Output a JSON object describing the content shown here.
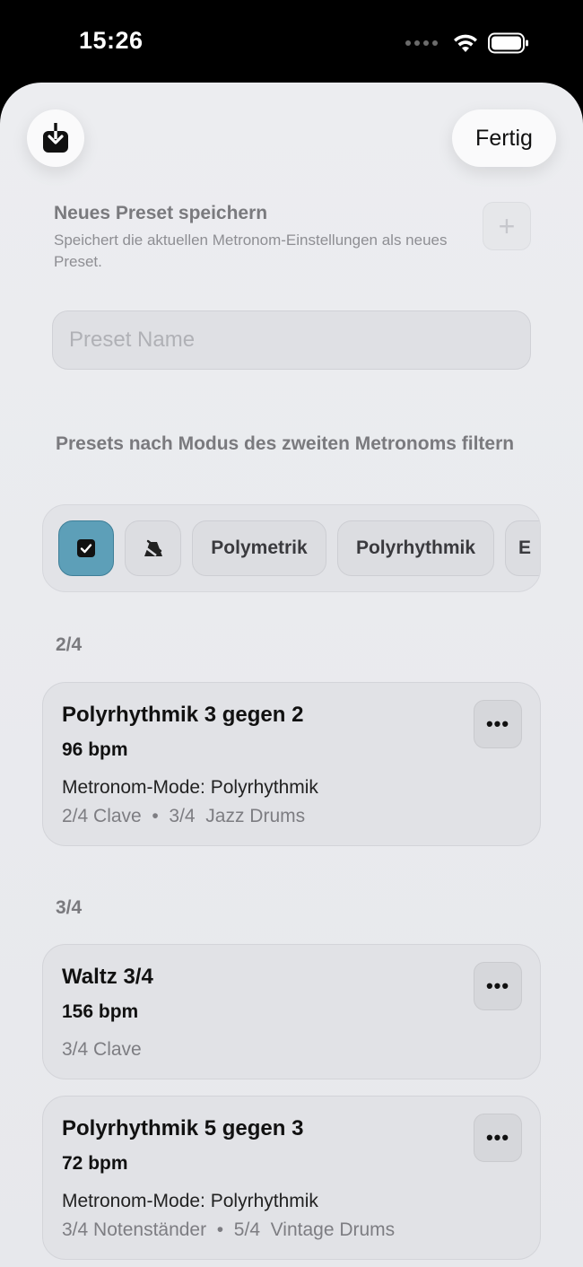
{
  "status_bar": {
    "time": "15:26"
  },
  "header": {
    "done_label": "Fertig"
  },
  "save_section": {
    "title": "Neues Preset speichern",
    "description": "Speichert die aktuellen Metronom-Einstellungen als neues Preset.",
    "add_label": "+"
  },
  "preset_name": {
    "placeholder": "Preset Name",
    "value": ""
  },
  "filter": {
    "title": "Presets nach Modus des zweiten Metronoms filtern",
    "chips": [
      "Polymetrik",
      "Polyrhythmik",
      "E"
    ]
  },
  "sections": [
    {
      "header": "2/4",
      "presets": [
        {
          "name": "Polyrhythmik 3 gegen 2",
          "bpm": "96 bpm",
          "mode": "Metronom-Mode: Polyrhythmik",
          "tracks": "2/4 Clave  •  3/4  Jazz Drums"
        }
      ]
    },
    {
      "header": "3/4",
      "presets": [
        {
          "name": "Waltz 3/4",
          "bpm": "156 bpm",
          "mode": "",
          "tracks": "3/4 Clave"
        },
        {
          "name": "Polyrhythmik 5 gegen 3",
          "bpm": "72 bpm",
          "mode": "Metronom-Mode: Polyrhythmik",
          "tracks": "3/4 Notenständer  •  5/4  Vintage Drums"
        }
      ]
    }
  ],
  "more_label": "•••",
  "colors": {
    "selected_chip": "#5d9fb8",
    "sheet_bg": "#ecedf0",
    "status_bar_bg": "#000000"
  }
}
